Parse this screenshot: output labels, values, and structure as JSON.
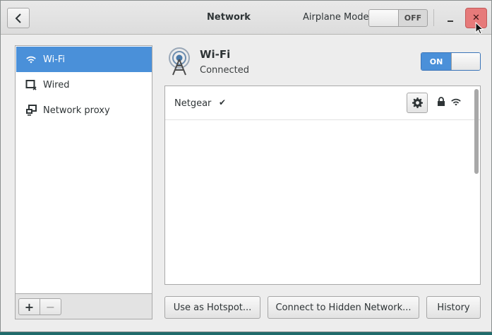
{
  "window": {
    "title": "Network",
    "airplane_label": "Airplane Mode",
    "airplane_state": "OFF",
    "close_glyph": "✕"
  },
  "sidebar": {
    "items": [
      {
        "label": "Wi-Fi",
        "icon": "wifi-icon",
        "selected": true
      },
      {
        "label": "Wired",
        "icon": "wired-icon",
        "selected": false
      },
      {
        "label": "Network proxy",
        "icon": "proxy-icon",
        "selected": false
      }
    ],
    "add_label": "+",
    "remove_label": "−"
  },
  "device": {
    "name": "Wi-Fi",
    "status": "Connected",
    "switch_state": "ON"
  },
  "networks": [
    {
      "name": "Netgear",
      "connected_mark": "✔",
      "secured": true,
      "signal": "wifi-signal-icon"
    }
  ],
  "buttons": {
    "hotspot": "Use as Hotspot...",
    "hidden_network": "Connect to Hidden Network...",
    "history": "History"
  },
  "colors": {
    "accent": "#4a90d9",
    "close": "#e67a7a"
  }
}
